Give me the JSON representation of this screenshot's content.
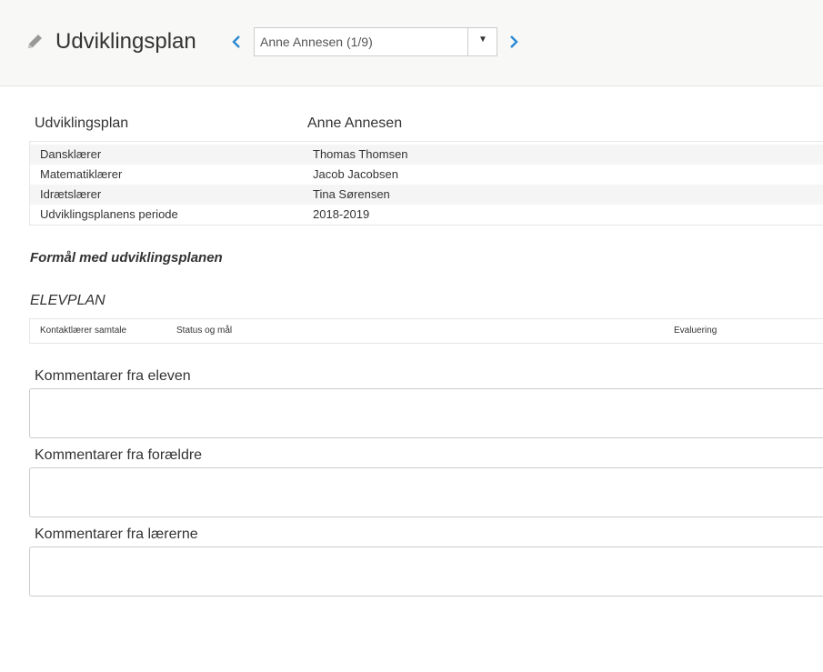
{
  "header": {
    "title": "Udviklingsplan",
    "student_select": {
      "value": "Anne Annesen (1/9)"
    }
  },
  "colors": {
    "accent": "#2a8ad4",
    "header_bg": "#f8f8f6",
    "icon": "#999999"
  },
  "icons": {
    "edit": "pencil-icon",
    "prev": "chevron-left-icon",
    "next": "chevron-right-icon",
    "dropdown": "caret-down-icon"
  },
  "info": {
    "heading_left": "Udviklingsplan",
    "heading_right": "Anne Annesen",
    "rows": [
      {
        "label": "Dansklærer",
        "value": "Thomas Thomsen"
      },
      {
        "label": "Matematiklærer",
        "value": "Jacob Jacobsen"
      },
      {
        "label": "Idrætslærer",
        "value": "Tina Sørensen"
      },
      {
        "label": "Udviklingsplanens periode",
        "value": "2018-2019"
      }
    ]
  },
  "purpose": {
    "title": "Formål med udviklingsplanen"
  },
  "elevplan": {
    "title": "ELEVPLAN",
    "columns": [
      "Kontaktlærer samtale",
      "Status og mål",
      "Evaluering"
    ]
  },
  "comments": [
    {
      "label": "Kommentarer fra eleven",
      "value": ""
    },
    {
      "label": "Kommentarer fra forældre",
      "value": ""
    },
    {
      "label": "Kommentarer fra lærerne",
      "value": ""
    }
  ]
}
